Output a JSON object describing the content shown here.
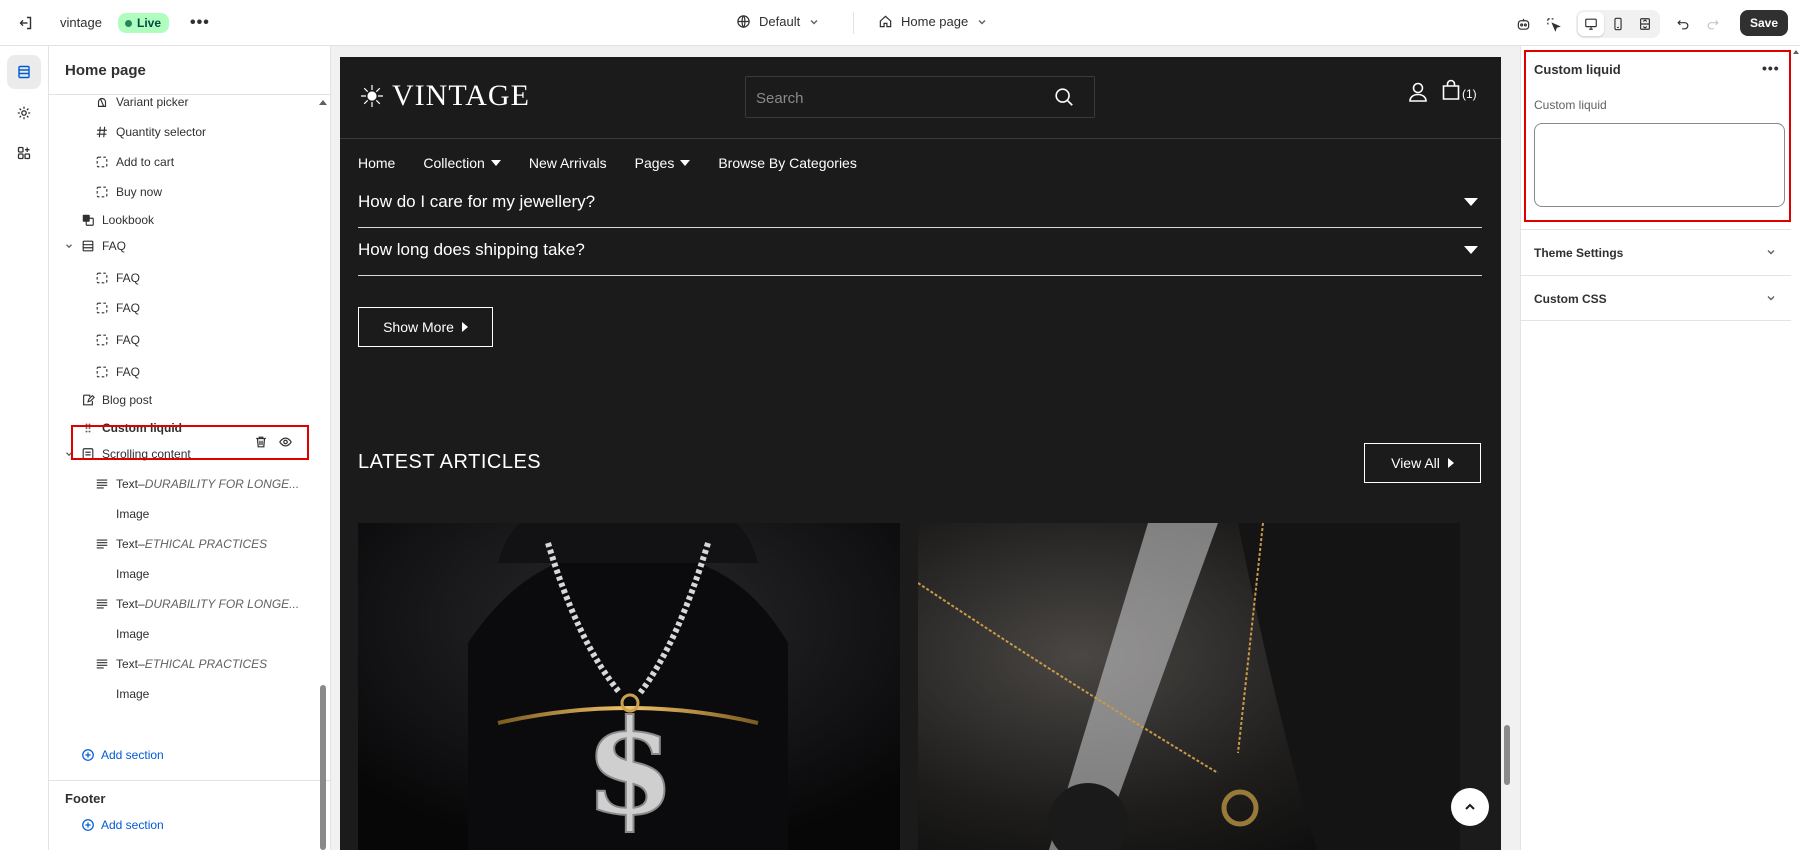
{
  "topbar": {
    "store_name": "vintage",
    "status_badge": "Live",
    "more_label": "•••",
    "theme_label": "Default",
    "page_label": "Home page",
    "save_label": "Save"
  },
  "sidebar": {
    "title": "Home page",
    "items": [
      {
        "label": "Variant picker",
        "icon": "variant-icon"
      },
      {
        "label": "Quantity selector",
        "icon": "hash-icon"
      },
      {
        "label": "Add to cart",
        "icon": "block-icon"
      },
      {
        "label": "Buy now",
        "icon": "block-icon"
      },
      {
        "label": "Lookbook",
        "icon": "lookbook-icon"
      },
      {
        "label": "FAQ",
        "icon": "section-icon"
      },
      {
        "label": "FAQ",
        "icon": "block-icon"
      },
      {
        "label": "FAQ",
        "icon": "block-icon"
      },
      {
        "label": "FAQ",
        "icon": "block-icon"
      },
      {
        "label": "FAQ",
        "icon": "block-icon"
      },
      {
        "label": "Blog post",
        "icon": "blog-icon"
      },
      {
        "label": "Custom liquid",
        "icon": "drag-handle-icon"
      },
      {
        "label": "Scrolling content",
        "icon": "section-icon"
      },
      {
        "label": "Text",
        "detail": "DURABILITY FOR LONGE...",
        "icon": "text-icon"
      },
      {
        "label": "Image",
        "icon": "none"
      },
      {
        "label": "Text",
        "detail": "ETHICAL PRACTICES",
        "icon": "text-icon"
      },
      {
        "label": "Image",
        "icon": "none"
      },
      {
        "label": "Text",
        "detail": "DURABILITY FOR LONGE...",
        "icon": "text-icon"
      },
      {
        "label": "Image",
        "icon": "none"
      },
      {
        "label": "Text",
        "detail": "ETHICAL PRACTICES",
        "icon": "text-icon"
      },
      {
        "label": "Image",
        "icon": "none"
      }
    ],
    "text_separator": " – ",
    "add_section_label": "Add section",
    "footer_title": "Footer",
    "footer_add_section_label": "Add section"
  },
  "preview": {
    "logo_text": "VINTAGE",
    "search_placeholder": "Search",
    "cart_count": "(1)",
    "nav": [
      {
        "label": "Home",
        "dropdown": false
      },
      {
        "label": "Collection",
        "dropdown": true
      },
      {
        "label": "New Arrivals",
        "dropdown": false
      },
      {
        "label": "Pages",
        "dropdown": true
      },
      {
        "label": "Browse By Categories",
        "dropdown": false
      }
    ],
    "faq": [
      "How do I care for my jewellery?",
      "How long does shipping take?"
    ],
    "show_more_label": "Show More",
    "latest_articles_title": "LATEST ARTICLES",
    "view_all_label": "View All"
  },
  "right_panel": {
    "title": "Custom liquid",
    "more_label": "•••",
    "field_label": "Custom liquid",
    "field_value": "",
    "accordions": [
      "Theme Settings",
      "Custom CSS"
    ]
  },
  "colors": {
    "accent_link": "#005bd3",
    "highlight_border": "#e00000",
    "live_badge_bg": "#affebf",
    "preview_bg": "#1b1b1b",
    "save_bg": "#303030"
  }
}
